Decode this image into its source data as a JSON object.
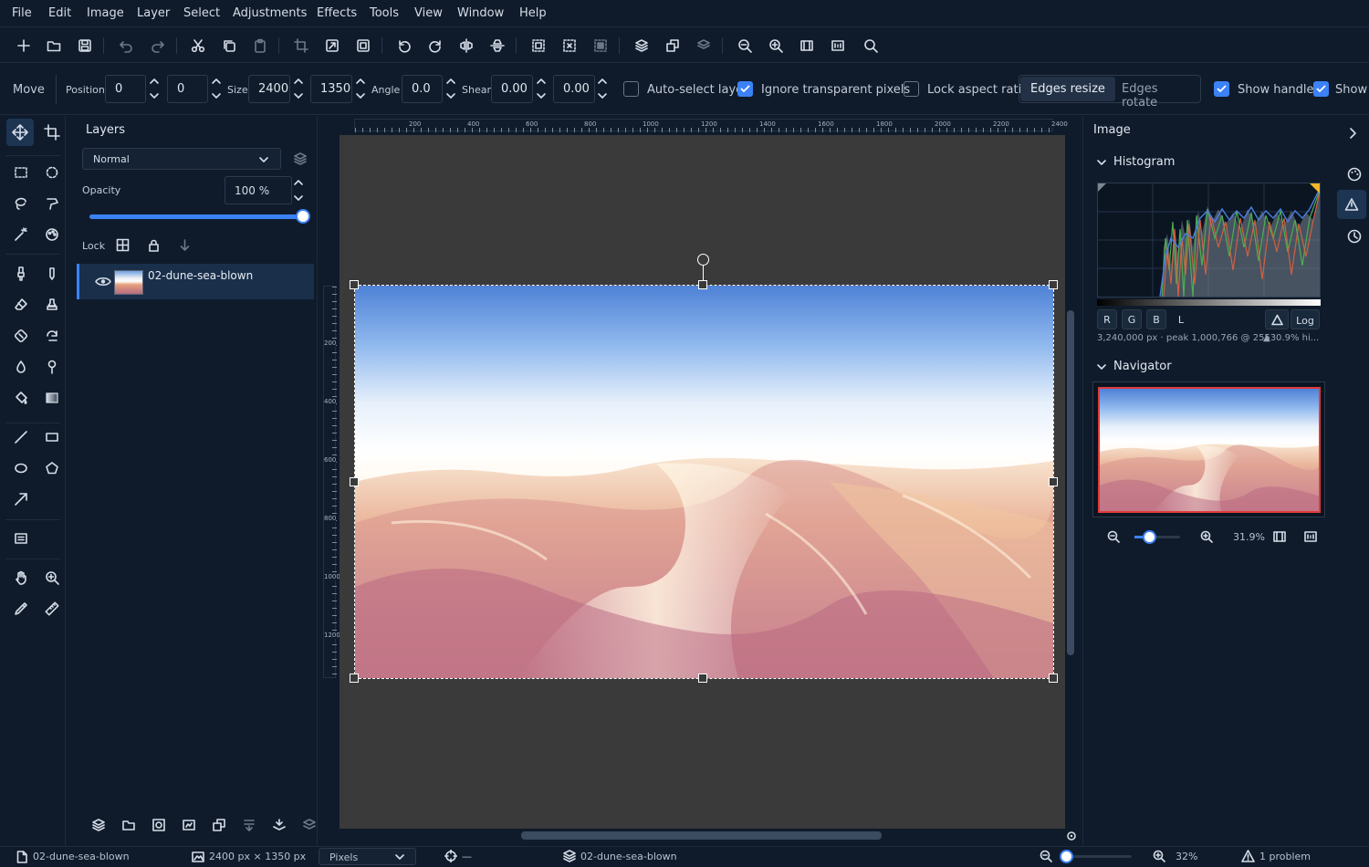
{
  "menu": [
    "File",
    "Edit",
    "Image",
    "Layer",
    "Select",
    "Adjustments",
    "Effects",
    "Tools",
    "View",
    "Window",
    "Help"
  ],
  "options": {
    "tool_name": "Move",
    "position_label": "Position",
    "pos_x": "0",
    "pos_y": "0",
    "size_label": "Size",
    "size_w": "2400",
    "size_h": "1350",
    "angle_label": "Angle",
    "angle": "0.0",
    "shear_label": "Shear",
    "shear_x": "0.00",
    "shear_y": "0.00",
    "auto_select": "Auto-select layer",
    "ignore_transparent": "Ignore transparent pixels",
    "lock_aspect": "Lock aspect ratio",
    "edges_resize": "Edges resize",
    "edges_rotate": "Edges rotate",
    "show_handles": "Show handles",
    "show_more": "Show"
  },
  "layers": {
    "title": "Layers",
    "blend_mode": "Normal",
    "opacity_label": "Opacity",
    "opacity_value": "100 %",
    "opacity_fraction": 1.0,
    "lock_label": "Lock",
    "items": [
      {
        "name": "02-dune-sea-blown",
        "visible": true,
        "selected": true
      }
    ]
  },
  "canvas": {
    "h_ruler": [
      "200",
      "400",
      "600",
      "800",
      "1000",
      "1200",
      "1400",
      "1600",
      "1800",
      "2000",
      "2200",
      "2400"
    ],
    "v_ruler": [
      "200",
      "400",
      "600",
      "800",
      "1000",
      "1200"
    ]
  },
  "right": {
    "title": "Image",
    "histogram_title": "Histogram",
    "channels": [
      "R",
      "G",
      "B",
      "L"
    ],
    "log_label": "Log",
    "hist_info": "3,240,000 px · peak 1,000,766 @ 255",
    "hist_clip": "▲30.9% hi...",
    "navigator_title": "Navigator",
    "nav_zoom": "31.9%"
  },
  "status": {
    "doc_name": "02-dune-sea-blown",
    "dimensions": "2400 px × 1350 px",
    "units": "Pixels",
    "cursor": "—",
    "layer_name": "02-dune-sea-blown",
    "zoom": "32%",
    "problems": "1 problem"
  },
  "colors": {
    "accent": "#3b82f6",
    "panel_bg": "#0f1b2b",
    "canvas_bg": "#3a3a3a",
    "navigator_frame": "#e03a3a"
  }
}
